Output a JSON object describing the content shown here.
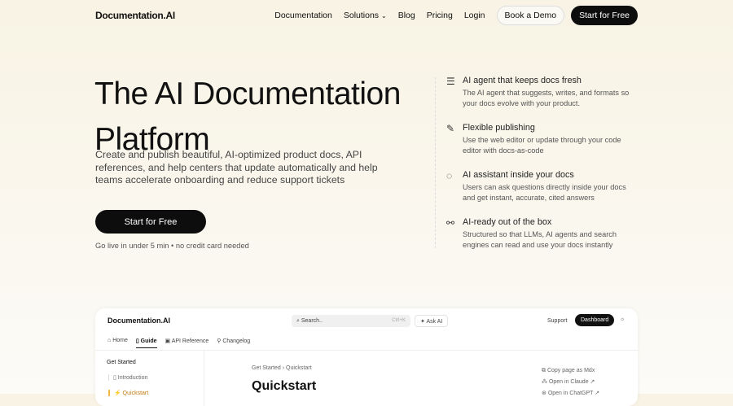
{
  "nav": {
    "logo": "Documentation.AI",
    "links": [
      "Documentation",
      "Solutions",
      "Blog",
      "Pricing",
      "Login"
    ],
    "book": "Book a Demo",
    "start": "Start for Free"
  },
  "hero": {
    "title": "The AI Documentation Platform",
    "subtitle": "Create and publish beautiful, AI-optimized product docs, API references, and help centers that update automatically and help teams accelerate onboarding and reduce support tickets",
    "cta": "Start for Free",
    "note": "Go live in under 5 min • no credit card needed"
  },
  "features": [
    {
      "icon": "list-scan-icon",
      "title": "AI agent that keeps docs fresh",
      "desc": "The AI agent that suggests, writes, and formats so your docs evolve with your product."
    },
    {
      "icon": "pen-tool-icon",
      "title": "Flexible publishing",
      "desc": "Use the web editor or update through your code editor with docs-as-code"
    },
    {
      "icon": "chat-bubble-icon",
      "title": "AI assistant inside your docs",
      "desc": "Users can ask questions directly inside your docs and get instant, accurate, cited answers"
    },
    {
      "icon": "route-icon",
      "title": "AI-ready out of the box",
      "desc": "Structured so that LLMs, AI agents and search engines can read and use your docs instantly"
    }
  ],
  "preview": {
    "logo": "Documentation.AI",
    "search": "Search..",
    "shortcut": "Ctrl+K",
    "ask": "Ask AI",
    "support": "Support",
    "dashboard": "Dashboard",
    "tabs": [
      "Home",
      "Guide",
      "API Reference",
      "Changelog"
    ],
    "section": "Get Started",
    "items": [
      "Introduction",
      "Quickstart"
    ],
    "breadcrumb": "Get Started › Quickstart",
    "title": "Quickstart",
    "actions": [
      "Copy page as Mdx",
      "Open in Claude ↗",
      "Open in ChatGPT ↗"
    ]
  }
}
